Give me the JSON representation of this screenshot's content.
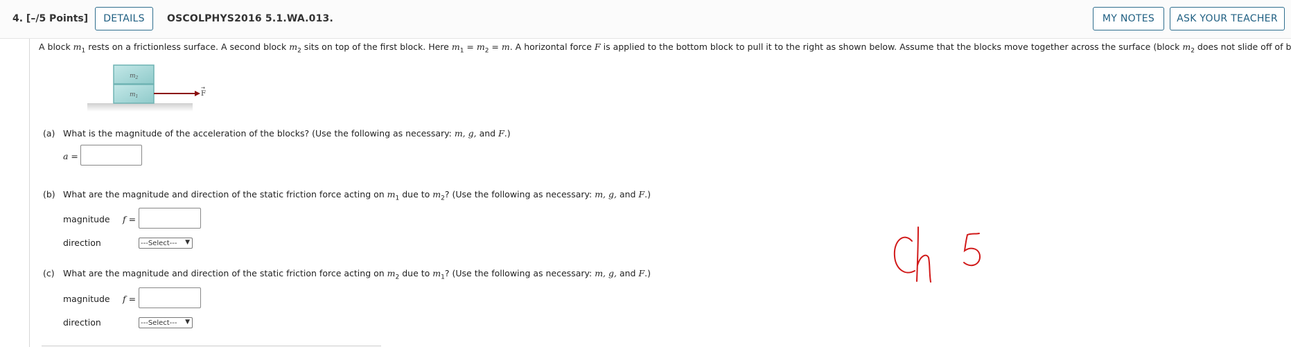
{
  "header": {
    "question_label": "4.  [–/5 Points]",
    "details_button": "DETAILS",
    "question_id": "OSCOLPHYS2016 5.1.WA.013.",
    "my_notes_button": "MY NOTES",
    "ask_teacher_button": "ASK YOUR TEACHER"
  },
  "statement": {
    "t1": "A block ",
    "t2": " rests on a frictionless surface. A second block ",
    "t3": " sits on top of the first block. Here ",
    "t4": " = ",
    "t5": " = ",
    "t6": ". A horizontal force ",
    "t7": " is applied to the bottom block to pull it to the right as shown below. Assume that the blocks move together across the surface (block ",
    "t8": " does not slide off of block ",
    "t9": ").",
    "m": "m",
    "sub1": "1",
    "sub2": "2",
    "F": "F"
  },
  "figure": {
    "top_block": "m",
    "top_sub": "2",
    "bottom_block": "m",
    "bottom_sub": "1",
    "force": "F"
  },
  "part_a": {
    "letter": "(a)",
    "question": "What is the magnitude of the acceleration of the blocks? (Use the following as necessary: ",
    "vars": "m, g,",
    "and": " and ",
    "F": "F",
    "end": ".)",
    "input_label": "a =",
    "input_value": ""
  },
  "part_b": {
    "letter": "(b)",
    "q1": "What are the magnitude and direction of the static friction force acting on ",
    "q2": " due to ",
    "q3": "? (Use the following as necessary: ",
    "m": "m",
    "sub_on": "1",
    "sub_due": "2",
    "vars": "m, g,",
    "and": " and ",
    "F": "F",
    "end": ".)",
    "magnitude_label": "magnitude",
    "f_label": "f =",
    "magnitude_value": "",
    "direction_label": "direction",
    "direction_selected": "---Select---"
  },
  "part_c": {
    "letter": "(c)",
    "q1": "What are the magnitude and direction of the static friction force acting on ",
    "q2": " due to ",
    "q3": "? (Use the following as necessary: ",
    "m": "m",
    "sub_on": "2",
    "sub_due": "1",
    "vars": "m, g,",
    "and": " and ",
    "F": "F",
    "end": ".)",
    "magnitude_label": "magnitude",
    "f_label": "f =",
    "magnitude_value": "",
    "direction_label": "direction",
    "direction_selected": "---Select---"
  },
  "annotation": {
    "handwritten": "Ch 5",
    "color": "#d11a1a"
  },
  "colors": {
    "accent": "#1f5f82",
    "force_arrow": "#8b0d0d",
    "block": "#9ed3d3"
  }
}
